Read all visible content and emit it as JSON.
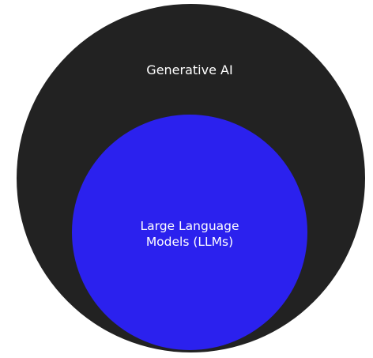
{
  "diagram": {
    "outer": {
      "label": "Generative AI",
      "color": "#222222"
    },
    "inner": {
      "label_lines": [
        "Large Language",
        "Models (LLMs)"
      ],
      "color": "#2b21ee"
    }
  }
}
